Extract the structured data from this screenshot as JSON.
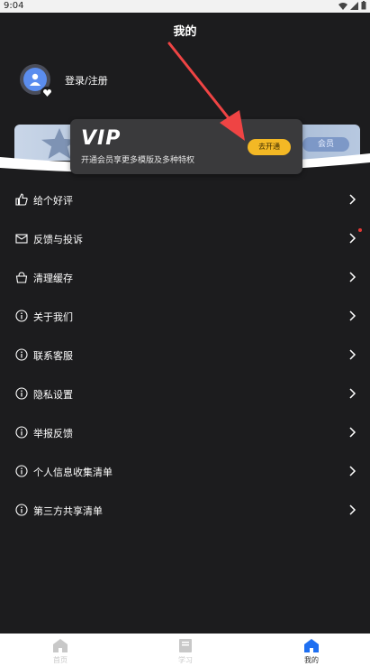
{
  "status_bar": {
    "time": "9:04"
  },
  "header": {
    "title": "我的"
  },
  "profile": {
    "login_label": "登录/注册"
  },
  "banner": {
    "button_label": "会员"
  },
  "vip_popup": {
    "logo": "VIP",
    "description": "开通会员享更多模版及多种特权",
    "button_label": "去开通"
  },
  "menu": {
    "items": [
      {
        "label": "给个好评",
        "icon": "thumbs-up-icon"
      },
      {
        "label": "反馈与投诉",
        "icon": "mail-icon",
        "badge": "red-dot"
      },
      {
        "label": "清理缓存",
        "icon": "basket-icon"
      },
      {
        "label": "关于我们",
        "icon": "info-icon"
      },
      {
        "label": "联系客服",
        "icon": "info-icon"
      },
      {
        "label": "隐私设置",
        "icon": "info-icon"
      },
      {
        "label": "举报反馈",
        "icon": "info-icon"
      },
      {
        "label": "个人信息收集清单",
        "icon": "info-icon"
      },
      {
        "label": "第三方共享清单",
        "icon": "info-icon"
      }
    ]
  },
  "tabbar": {
    "tabs": [
      {
        "label": "首页",
        "icon": "home-icon"
      },
      {
        "label": "学习",
        "icon": "book-icon"
      },
      {
        "label": "我的",
        "icon": "home-icon",
        "active": true
      }
    ]
  },
  "colors": {
    "accent": "#1e6ff1",
    "vip_button": "#f3b825",
    "arrow": "#ef4444"
  }
}
